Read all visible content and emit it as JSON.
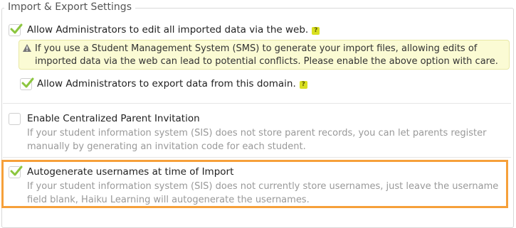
{
  "section": {
    "title": "Import & Export Settings"
  },
  "options": [
    {
      "label": "Allow Administrators to edit all imported data via the web.",
      "checked": true,
      "help_icon": "question-mark",
      "warning": "If you use a Student Management System (SMS) to generate your import files, allowing edits of imported data via the web can lead to potential conflicts. Please enable the above option with care."
    },
    {
      "label": "Allow Administrators to export data from this domain.",
      "checked": true,
      "help_icon": "question-mark"
    },
    {
      "label": "Enable Centralized Parent Invitation",
      "checked": false,
      "description": "If your student information system (SIS) does not store parent records, you can let parents register manually by generating an invitation code for each student."
    },
    {
      "label": "Autogenerate usernames at time of Import",
      "checked": true,
      "highlighted": true,
      "description": "If your student information system (SIS) does not currently store usernames, just leave the username field blank, Haiku Learning will autogenerate the usernames."
    }
  ],
  "colors": {
    "check": "#8cc63f",
    "help_badge": "#d9e021",
    "warning_bg": "#fbfbd4",
    "highlight_border": "#f6a03a",
    "muted_text": "#999999"
  }
}
